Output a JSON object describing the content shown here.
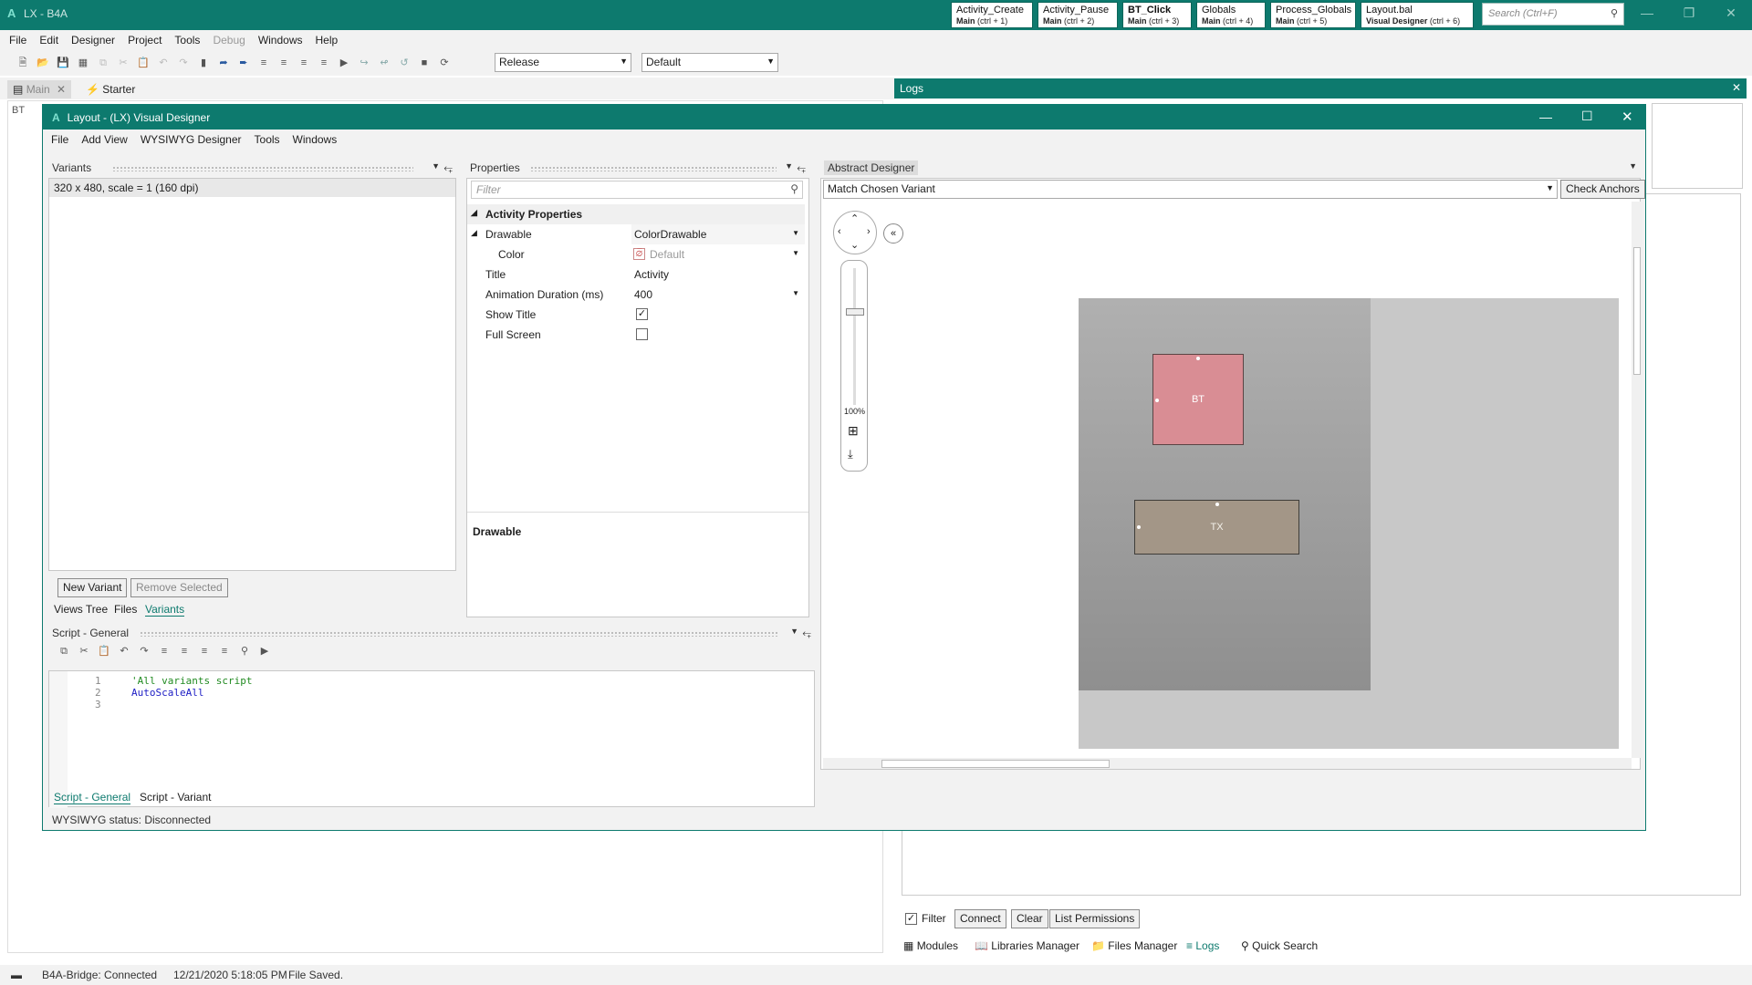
{
  "app": {
    "title": "LX - B4A",
    "quick_tabs": [
      {
        "title": "Activity_Create",
        "module": "Main",
        "shortcut": "(ctrl + 1)"
      },
      {
        "title": "Activity_Pause",
        "module": "Main",
        "shortcut": "(ctrl + 2)"
      },
      {
        "title": "BT_Click",
        "module": "Main",
        "shortcut": "(ctrl + 3)"
      },
      {
        "title": "Globals",
        "module": "Main",
        "shortcut": "(ctrl + 4)"
      },
      {
        "title": "Process_Globals",
        "module": "Main",
        "shortcut": "(ctrl + 5)"
      },
      {
        "title": "Layout.bal",
        "module": "Visual Designer",
        "shortcut": "(ctrl + 6)"
      }
    ],
    "search_placeholder": "Search (Ctrl+F)"
  },
  "menu": [
    "File",
    "Edit",
    "Designer",
    "Project",
    "Tools",
    "Debug",
    "Windows",
    "Help"
  ],
  "toolbar": {
    "build_config": "Release",
    "device_config": "Default"
  },
  "doc_tabs": {
    "main": "Main",
    "starter": "Starter",
    "bt": "BT"
  },
  "logs": {
    "title": "Logs",
    "filter_label": "Filter",
    "connect_label": "Connect",
    "clear_label": "Clear",
    "permissions_label": "List Permissions"
  },
  "bottom_tabs": [
    "Modules",
    "Libraries Manager",
    "Files Manager",
    "Logs",
    "Quick Search"
  ],
  "status": {
    "bridge": "B4A-Bridge: Connected",
    "timestamp": "12/21/2020 5:18:05 PM",
    "message": "File Saved."
  },
  "designer": {
    "title": "Layout - (LX) Visual Designer",
    "menu": [
      "File",
      "Add View",
      "WYSIWYG Designer",
      "Tools",
      "Windows"
    ],
    "variants": {
      "title": "Variants",
      "items": [
        "320 x 480, scale = 1 (160 dpi)"
      ],
      "new_label": "New Variant",
      "remove_label": "Remove Selected",
      "tabs": [
        "Views Tree",
        "Files",
        "Variants"
      ]
    },
    "properties": {
      "title": "Properties",
      "filter_placeholder": "Filter",
      "section": "Activity Properties",
      "rows": [
        {
          "key": "Drawable",
          "value": "ColorDrawable"
        },
        {
          "key": "Color",
          "value": "Default"
        },
        {
          "key": "Title",
          "value": "Activity"
        },
        {
          "key": "Animation Duration (ms)",
          "value": "400"
        },
        {
          "key": "Show Title",
          "value": "true"
        },
        {
          "key": "Full Screen",
          "value": "false"
        }
      ],
      "description": "Drawable"
    },
    "script": {
      "title": "Script - General",
      "lines": [
        "'All variants script",
        "AutoScaleAll",
        ""
      ],
      "tabs": [
        "Script - General",
        "Script - Variant"
      ]
    },
    "abstract": {
      "title": "Abstract Designer",
      "variant_select": "Match Chosen Variant",
      "check_anchors": "Check Anchors",
      "zoom": "100%",
      "views": [
        "BT",
        "TX"
      ]
    },
    "status": "WYSIWYG status: Disconnected"
  }
}
